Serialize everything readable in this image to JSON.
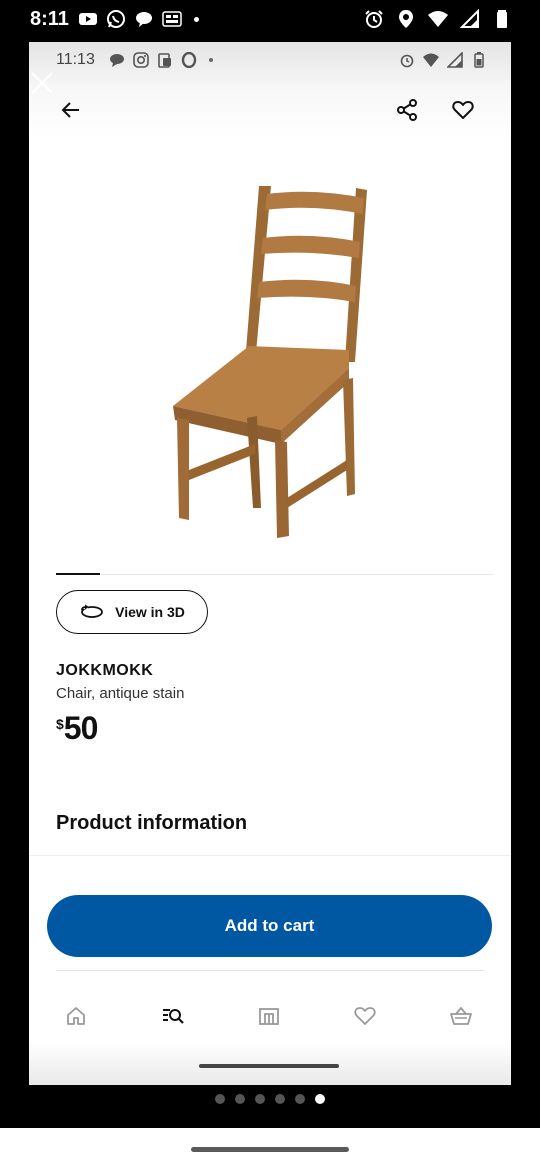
{
  "system_status": {
    "time": "8:11",
    "left_icons": [
      "youtube-icon",
      "whatsapp-icon",
      "chat-bubble-icon",
      "temu-icon"
    ],
    "right_icons": [
      "alarm-icon",
      "location-icon",
      "wifi-icon",
      "signal-icon",
      "battery-icon"
    ]
  },
  "inner_status": {
    "time": "11:13",
    "left_icons": [
      "message-icon",
      "instagram-icon",
      "clipboard-icon",
      "opera-icon"
    ],
    "right_icons": [
      "alarm-icon",
      "wifi-icon",
      "signal-icon",
      "battery-icon"
    ]
  },
  "header": {
    "back_icon": "arrow-left-icon",
    "share_icon": "share-icon",
    "favorite_icon": "heart-icon"
  },
  "product": {
    "view_3d_label": "View in 3D",
    "name": "JOKKMOKK",
    "description": "Chair, antique stain",
    "price_currency": "$",
    "price_amount": "50"
  },
  "sections": {
    "product_information": "Product information"
  },
  "cart": {
    "add_to_cart_label": "Add to cart"
  },
  "bottom_nav": [
    {
      "id": "home",
      "icon": "home-icon"
    },
    {
      "id": "search",
      "icon": "search-list-icon"
    },
    {
      "id": "rooms",
      "icon": "store-icon"
    },
    {
      "id": "wishlist",
      "icon": "heart-icon"
    },
    {
      "id": "cart",
      "icon": "shopping-basket-icon"
    }
  ],
  "page_indicator": {
    "count": 6,
    "active_index": 5
  },
  "colors": {
    "primary_blue": "#0058a3",
    "wood_stain": "#a9763f"
  }
}
